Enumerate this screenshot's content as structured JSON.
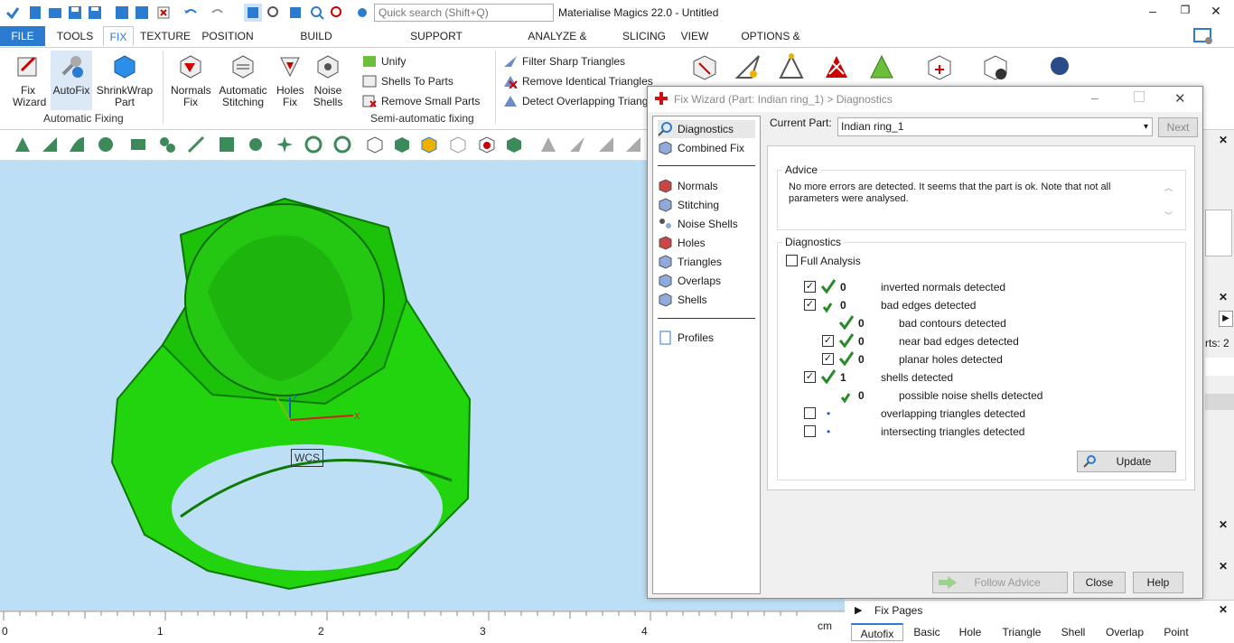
{
  "app": {
    "title": "Materialise Magics 22.0 - Untitled",
    "search_placeholder": "Quick search (Shift+Q)"
  },
  "menu": {
    "tabs": [
      "FILE",
      "TOOLS",
      "FIX",
      "TEXTURE",
      "POSITION",
      "BUILD PREPARATION",
      "SUPPORT GENERATION",
      "ANALYZE & REPORT",
      "SLICING",
      "VIEW",
      "OPTIONS & HELP"
    ]
  },
  "ribbon": {
    "fix_wizard": "Fix Wizard",
    "autofix": "AutoFix",
    "shrinkwrap": "ShrinkWrap Part",
    "normals_fix": "Normals Fix",
    "auto_stitching": "Automatic Stitching",
    "holes_fix": "Holes Fix",
    "noise_shells": "Noise Shells",
    "unify": "Unify",
    "shells_to_parts": "Shells To Parts",
    "remove_small_parts": "Remove Small Parts",
    "filter_sharp": "Filter Sharp Triangles",
    "remove_identical": "Remove Identical Triangles",
    "detect_overlapping": "Detect Overlapping Triang",
    "group_auto": "Automatic Fixing",
    "group_semi": "Semi-automatic fixing"
  },
  "viewport": {
    "wcs": "WCS"
  },
  "ruler": {
    "ticks": [
      "0",
      "1",
      "2",
      "3",
      "4"
    ],
    "unit": "cm"
  },
  "right_panel": {
    "parts_label": "rts: 2",
    "fix_pages_title": "Fix Pages",
    "tabs": [
      "Autofix",
      "Basic",
      "Hole",
      "Triangle",
      "Shell",
      "Overlap",
      "Point"
    ]
  },
  "dialog": {
    "title": "Fix Wizard (Part: Indian ring_1) > Diagnostics",
    "nav": {
      "diagnostics": "Diagnostics",
      "combined_fix": "Combined Fix",
      "normals": "Normals",
      "stitching": "Stitching",
      "noise_shells": "Noise Shells",
      "holes": "Holes",
      "triangles": "Triangles",
      "overlaps": "Overlaps",
      "shells": "Shells",
      "profiles": "Profiles"
    },
    "current_part_label": "Current Part:",
    "current_part_value": "Indian ring_1",
    "next": "Next",
    "advice_title": "Advice",
    "advice_text": "No more errors are detected. It seems that the part is ok. Note that not all parameters were analysed.",
    "diagnostics_title": "Diagnostics",
    "full_analysis": "Full Analysis",
    "rows": [
      {
        "count": "0",
        "label": "inverted normals detected"
      },
      {
        "count": "0",
        "label": "bad edges detected"
      },
      {
        "count": "0",
        "label": "bad contours detected"
      },
      {
        "count": "0",
        "label": "near bad edges detected"
      },
      {
        "count": "0",
        "label": "planar holes detected"
      },
      {
        "count": "1",
        "label": "shells detected"
      },
      {
        "count": "0",
        "label": "possible noise shells detected"
      },
      {
        "count": "",
        "label": "overlapping triangles detected"
      },
      {
        "count": "",
        "label": "intersecting triangles detected"
      }
    ],
    "update": "Update",
    "follow_advice": "Follow Advice",
    "close": "Close",
    "help": "Help"
  },
  "colors": {
    "accent": "#2b7bd1",
    "ring": "#22d40e",
    "viewport": "#bcdff5",
    "check": "#2a8a2a"
  }
}
